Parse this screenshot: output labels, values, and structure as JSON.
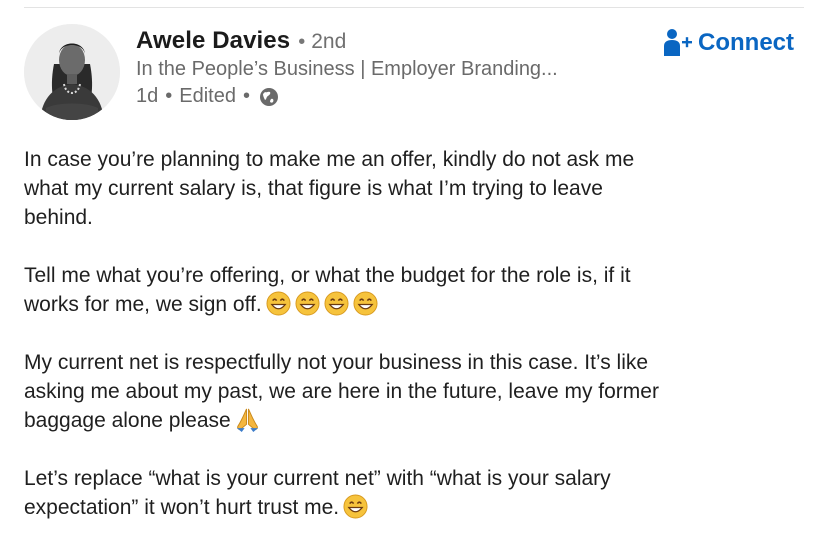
{
  "author": {
    "name": "Awele Davies",
    "separator": "•",
    "degree": "2nd",
    "headline": "In the People’s Business | Employer Branding...",
    "time": "1d",
    "edited": "Edited",
    "visibility_icon": "globe-icon"
  },
  "actions": {
    "connect_label": "Connect",
    "connect_icon": "add-person-icon",
    "accent_color": "#0a66c2"
  },
  "post": {
    "paragraphs": [
      "In case you’re planning to make me an offer, kindly do not ask me\nwhat my current salary is, that figure is what I’m trying to leave\nbehind.",
      "Tell me what you’re offering, or what the budget for the role is, if it\nworks for me, we sign off.",
      "My current net is respectfully not your business in this case. It’s like\nasking me about my past, we are here in the future, leave my former\nbaggage alone please",
      "Let’s replace “what is your current net” with “what is your salary\nexpectation” it won’t hurt trust me."
    ],
    "emojis": {
      "p2": [
        "grinning-face-icon",
        "grinning-face-icon",
        "grinning-face-icon",
        "grinning-face-icon"
      ],
      "p3": [
        "folded-hands-icon"
      ],
      "p4": [
        "grinning-face-icon"
      ]
    }
  }
}
